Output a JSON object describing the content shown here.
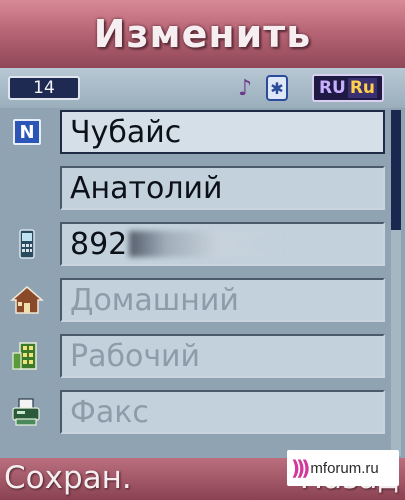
{
  "header": {
    "title": "Изменить"
  },
  "status": {
    "counter": "14",
    "icons": [
      "music-note-icon",
      "bluetooth-icon",
      "language-icon"
    ],
    "bt_glyph": "✱",
    "language_a": "RU",
    "language_b": "Ru"
  },
  "form": {
    "fields": [
      {
        "icon": "name-icon",
        "icon_glyph": "N",
        "value": "Чубайс",
        "placeholder": "",
        "selected": true
      },
      {
        "icon": "",
        "value": "Анатолий",
        "placeholder": ""
      },
      {
        "icon": "mobile-phone-icon",
        "value": "892",
        "obscured": true,
        "placeholder": ""
      },
      {
        "icon": "home-icon",
        "value": "",
        "placeholder": "Домашний"
      },
      {
        "icon": "office-building-icon",
        "value": "",
        "placeholder": "Рабочий"
      },
      {
        "icon": "fax-icon",
        "value": "",
        "placeholder": "Факс"
      }
    ]
  },
  "softkeys": {
    "left": "Сохран.",
    "right": "Назад"
  },
  "watermark": {
    "mark": ")))",
    "text": "mforum.ru"
  },
  "colors": {
    "title_bar": "#b86676",
    "softkey_bar": "#9a4f5f",
    "field_bg": "#c3d1dc",
    "counter_bg": "#1f2a52"
  }
}
